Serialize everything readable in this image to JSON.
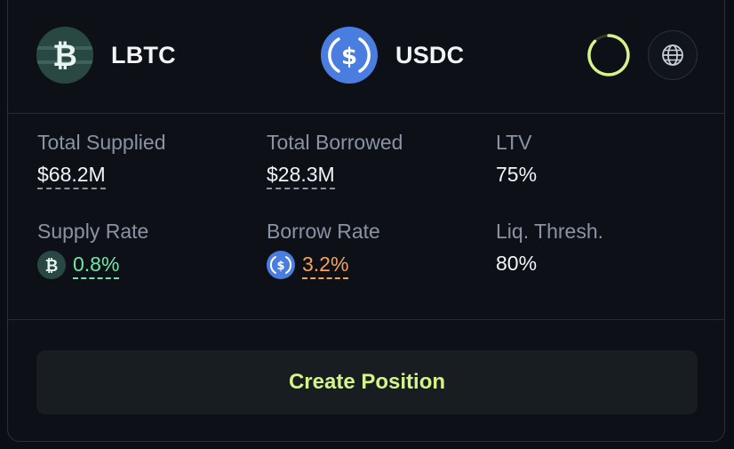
{
  "pair": {
    "collateral": {
      "symbol": "LBTC",
      "icon": "bitcoin-icon"
    },
    "debt": {
      "symbol": "USDC",
      "icon": "usdc-icon"
    }
  },
  "header": {
    "status_icon": "loading-ring-icon",
    "network_icon": "globe-icon"
  },
  "stats": {
    "total_supplied": {
      "label": "Total Supplied",
      "value": "$68.2M"
    },
    "total_borrowed": {
      "label": "Total Borrowed",
      "value": "$28.3M"
    },
    "ltv": {
      "label": "LTV",
      "value": "75%"
    },
    "supply_rate": {
      "label": "Supply Rate",
      "value": "0.8%",
      "icon": "bitcoin-icon"
    },
    "borrow_rate": {
      "label": "Borrow Rate",
      "value": "3.2%",
      "icon": "usdc-icon"
    },
    "liq_thresh": {
      "label": "Liq. Thresh.",
      "value": "80%"
    }
  },
  "actions": {
    "create_position": "Create Position"
  },
  "colors": {
    "background": "#0d1117",
    "accent": "#d6f28a",
    "supply_rate": "#6ee7a8",
    "borrow_rate": "#f5a25b",
    "usdc_blue": "#4a7de0",
    "lbtc_bg": "#1f3a36"
  }
}
